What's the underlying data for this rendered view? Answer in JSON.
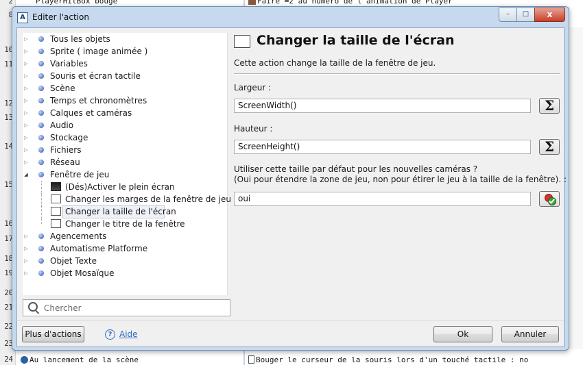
{
  "background": {
    "line_numbers": [
      "2",
      "8",
      "10",
      "11",
      "12",
      "13",
      "14",
      "15",
      "16",
      "17",
      "18",
      "19",
      "20",
      "21",
      "22",
      "23",
      "24"
    ],
    "top_left_code": "PlayerHitBox bouge",
    "top_right_code": "Faire =2 au numéro de l'animation de Player",
    "bottom_left_code": "Au lancement de la scène",
    "bottom_right_code": "Bouger le curseur de la souris lors d'un touché tactile : no"
  },
  "dialog": {
    "title": "Editer l'action",
    "app_icon_letter": "A",
    "controls": {
      "minimize": "–",
      "maximize": "□",
      "close": "x"
    },
    "tree": {
      "categories": [
        {
          "label": "Tous les objets"
        },
        {
          "label": "Sprite ( image animée )"
        },
        {
          "label": "Variables"
        },
        {
          "label": "Souris et écran tactile"
        },
        {
          "label": "Scène"
        },
        {
          "label": "Temps et chronomètres"
        },
        {
          "label": "Calques et caméras"
        },
        {
          "label": "Audio"
        },
        {
          "label": "Stockage"
        },
        {
          "label": "Fichiers"
        },
        {
          "label": "Réseau"
        },
        {
          "label": "Fenêtre de jeu"
        }
      ],
      "children": [
        {
          "label": "(Dés)Activer le plein écran"
        },
        {
          "label": "Changer les marges de la fenêtre de jeu"
        },
        {
          "label": "Changer la taille de l'écran"
        },
        {
          "label": "Changer le titre de la fenêtre"
        }
      ],
      "after": [
        {
          "label": "Agencements"
        },
        {
          "label": "Automatisme Platforme"
        },
        {
          "label": "Objet Texte"
        },
        {
          "label": "Objet Mosaïque"
        }
      ]
    },
    "search": {
      "placeholder": "Chercher",
      "value": ""
    },
    "action": {
      "title": "Changer la taille de l'écran",
      "description": "Cette action change la taille de la fenêtre de jeu.",
      "params": [
        {
          "label": "Largeur :",
          "value": "ScreenWidth()"
        },
        {
          "label": "Hauteur :",
          "value": "ScreenHeight()"
        },
        {
          "label_line1": "Utiliser cette taille par défaut pour les nouvelles caméras ?",
          "label_line2": "(Oui pour étendre la zone de jeu, non pour étirer le jeu à la taille de la fenêtre). :",
          "value": "oui"
        }
      ],
      "sigma": "Σ"
    },
    "buttons": {
      "more_actions": "Plus d'actions",
      "help": "Aide",
      "help_icon": "?",
      "ok": "Ok",
      "cancel": "Annuler"
    }
  }
}
